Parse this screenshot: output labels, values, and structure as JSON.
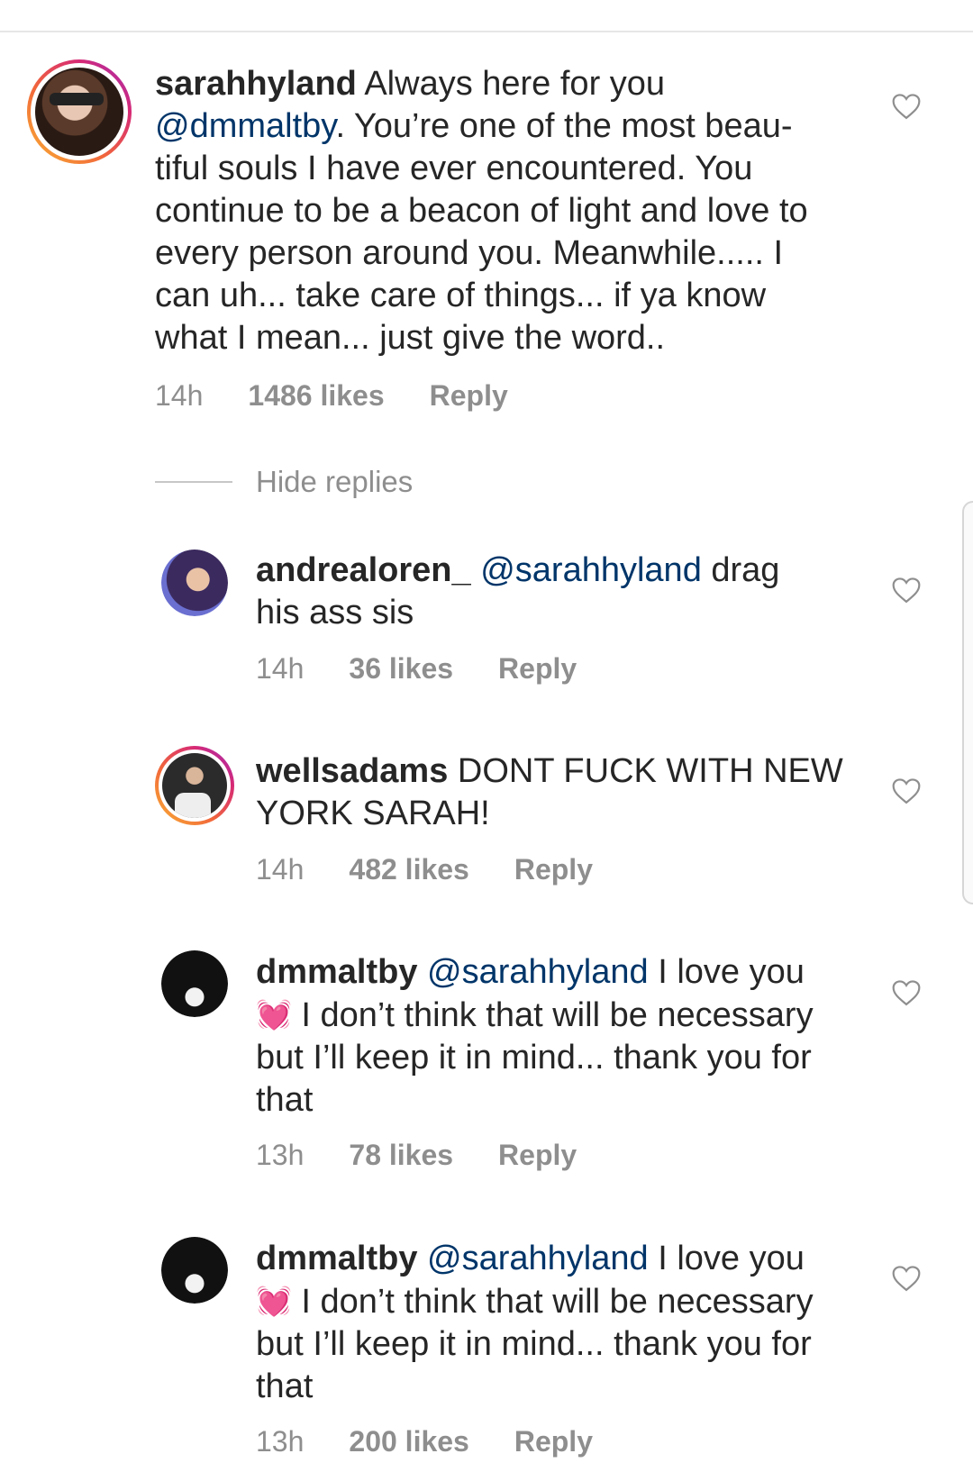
{
  "comments": [
    {
      "username": "sarahhyland",
      "text_1": " Always here for you ",
      "mention": "@dmmaltby",
      "text_2": ". You’re one of the most beau-tiful souls I have ever encountered. You continue to be a beacon of light and love to every person around you. Meanwhile..... I can uh... take care of things... if ya know what I mean... just give the word..",
      "time": "14h",
      "likes": "1486 likes",
      "reply": "Reply"
    }
  ],
  "hide_replies_label": "Hide replies",
  "replies": [
    {
      "username": "andrealoren_",
      "mention": "@sarahhyland",
      "text": " drag his ass sis",
      "time": "14h",
      "likes": "36 likes",
      "reply": "Reply"
    },
    {
      "username": "wellsadams",
      "text": " DONT FUCK WITH NEW YORK SARAH!",
      "time": "14h",
      "likes": "482 likes",
      "reply": "Reply"
    },
    {
      "username": "dmmaltby",
      "mention": "@sarahhyland",
      "text_1": " I love you ",
      "emoji": "💓",
      "text_2": " I don’t think that will be necessary but I’ll keep it in mind... thank you for that",
      "time": "13h",
      "likes": "78 likes",
      "reply": "Reply"
    },
    {
      "username": "dmmaltby",
      "mention": "@sarahhyland",
      "text_1": " I love you ",
      "emoji": "💓",
      "text_2": " I don’t think that will be necessary but I’ll keep it in mind... thank you for that",
      "time": "13h",
      "likes": "200 likes",
      "reply": "Reply"
    }
  ],
  "colors": {
    "text": "#262626",
    "mention": "#003569",
    "meta": "#8e8e8e",
    "emoji": "#ff2f8a"
  },
  "icons": {
    "like": "heart-outline-icon"
  }
}
